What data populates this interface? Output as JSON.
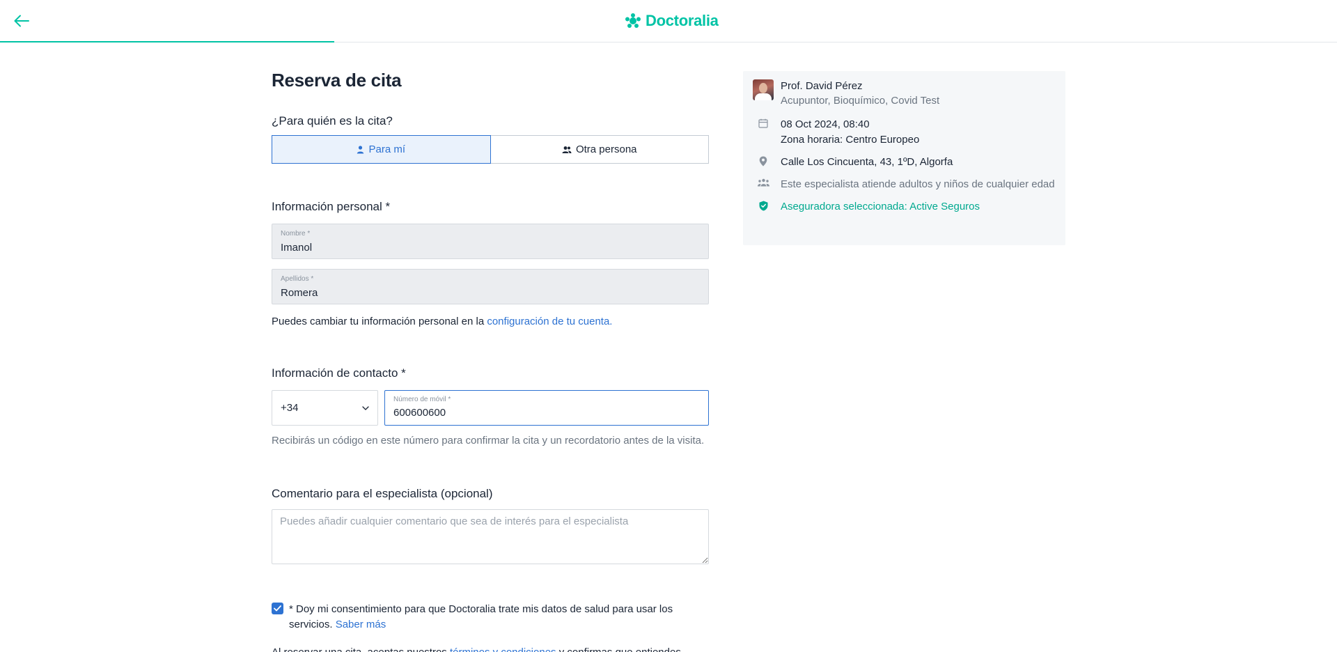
{
  "header": {
    "brand": "Doctoralia",
    "progress_fraction": 0.25
  },
  "main": {
    "title": "Reserva de cita",
    "for_whom": {
      "question": "¿Para quién es la cita?",
      "options": [
        "Para mí",
        "Otra persona"
      ],
      "selected": "Para mí"
    },
    "personal": {
      "title": "Información personal *",
      "first_name_label": "Nombre *",
      "first_name_value": "Imanol",
      "last_name_label": "Apellidos *",
      "last_name_value": "Romera",
      "helper_prefix": "Puedes cambiar tu información personal en la ",
      "helper_link": "configuración de tu cuenta."
    },
    "contact": {
      "title": "Información de contacto *",
      "country_code": "+34",
      "phone_label": "Número de móvil *",
      "phone_value": "600600600",
      "helper": "Recibirás un código en este número para confirmar la cita y un recordatorio antes de la visita."
    },
    "comment": {
      "title": "Comentario para el especialista (opcional)",
      "placeholder": "Puedes añadir cualquier comentario que sea de interés para el especialista"
    },
    "consent": {
      "checked": true,
      "text": "* Doy mi consentimiento para que Doctoralia trate mis datos de salud para usar los servicios.",
      "link": "Saber más"
    },
    "terms": {
      "prefix": "Al reservar una cita, aceptas nuestros ",
      "link": "términos y condiciones",
      "suffix": " y confirmas que entiendes"
    }
  },
  "summary": {
    "doctor_name": "Prof. David Pérez",
    "specialties": "Acupuntor, Bioquímico, Covid Test",
    "datetime": "08 Oct 2024, 08:40",
    "timezone": "Zona horaria: Centro Europeo",
    "address": "Calle Los Cincuenta, 43, 1ºD, Algorfa",
    "audience": "Este especialista atiende adultos y niños de cualquier edad",
    "insurance": "Aseguradora seleccionada: Active Seguros"
  },
  "colors": {
    "brand": "#00c3a5",
    "accent": "#2d72d2",
    "text": "#1b2535",
    "muted": "#6a7480"
  },
  "icons": [
    "arrow-left-icon",
    "doctoralia-logo-icon",
    "person-icon",
    "people-icon",
    "chevron-down-icon",
    "calendar-icon",
    "location-pin-icon",
    "group-icon",
    "shield-check-icon",
    "check-icon"
  ]
}
